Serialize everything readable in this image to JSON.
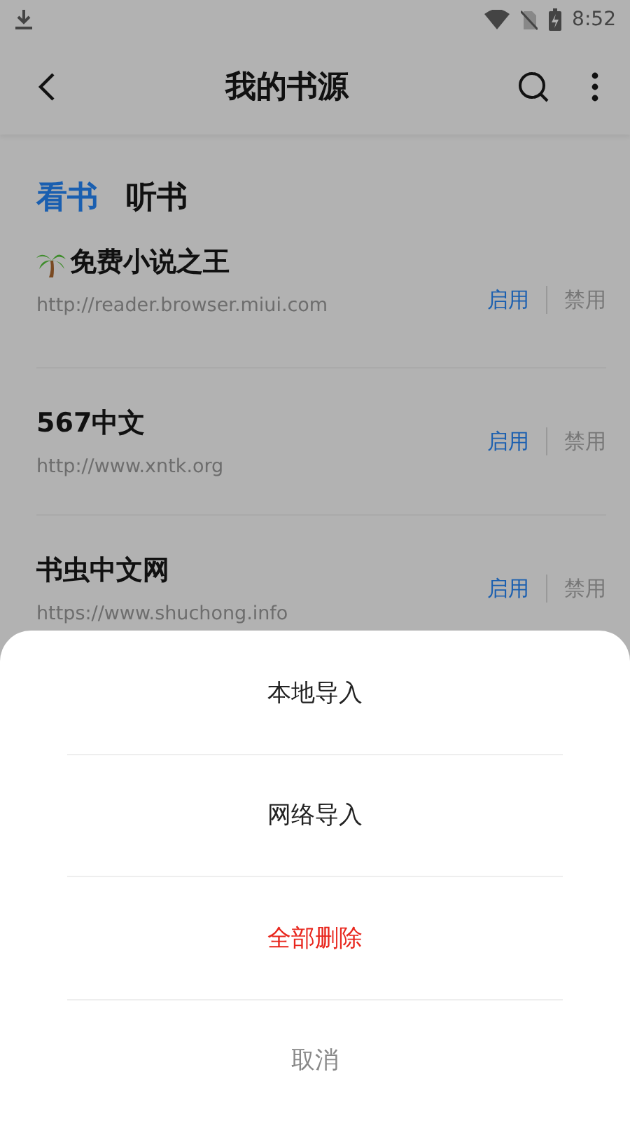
{
  "status_bar": {
    "time": "8:52"
  },
  "header": {
    "title": "我的书源"
  },
  "tabs": [
    {
      "label": "看书",
      "selected": true
    },
    {
      "label": "听书",
      "selected": false
    }
  ],
  "sources": [
    {
      "name": "免费小说之王",
      "icon": true,
      "url": "http://reader.browser.miui.com",
      "enable": "启用",
      "disable": "禁用",
      "enabled": true
    },
    {
      "name": "567中文",
      "icon": false,
      "url": "http://www.xntk.org",
      "enable": "启用",
      "disable": "禁用",
      "enabled": true
    },
    {
      "name": "书虫中文网",
      "icon": false,
      "url": "https://www.shuchong.info",
      "enable": "启用",
      "disable": "禁用",
      "enabled": true
    }
  ],
  "action_sheet": {
    "items": [
      {
        "label": "本地导入",
        "kind": "normal"
      },
      {
        "label": "网络导入",
        "kind": "normal"
      },
      {
        "label": "全部删除",
        "kind": "danger"
      },
      {
        "label": "取消",
        "kind": "cancel"
      }
    ]
  }
}
